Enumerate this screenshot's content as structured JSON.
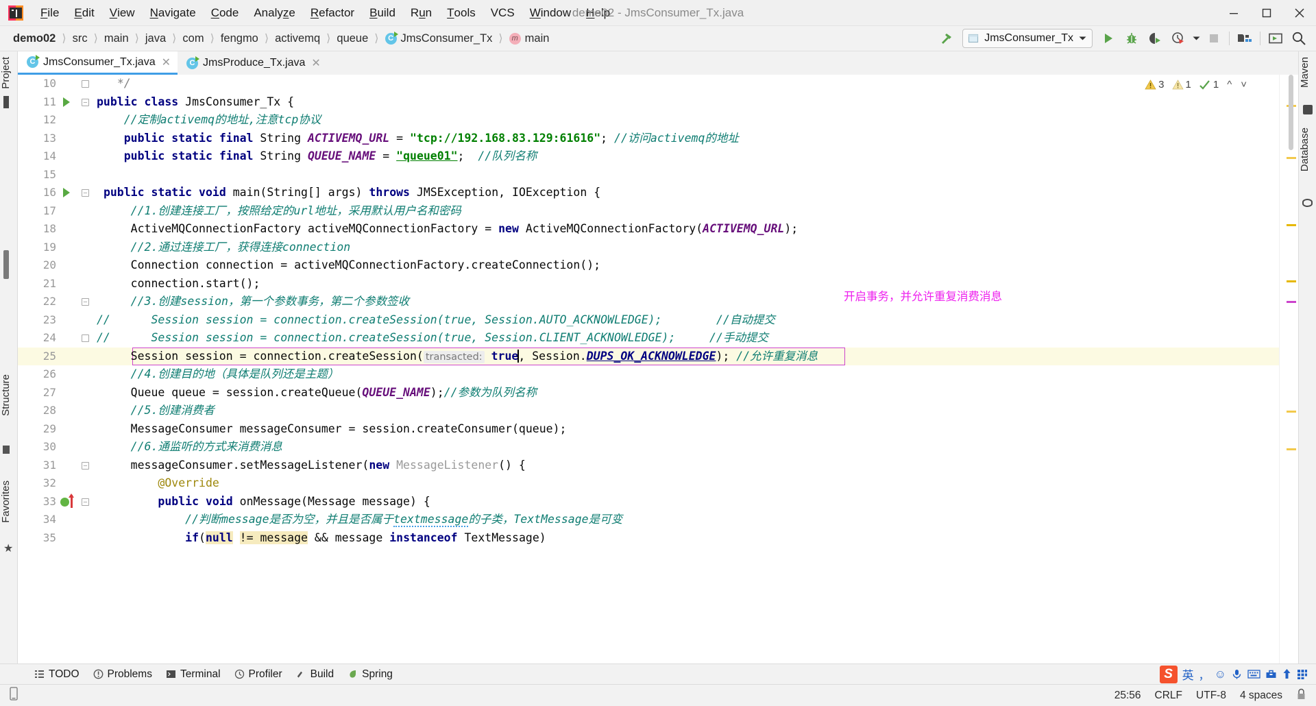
{
  "window": {
    "title": "demo02 - JmsConsumer_Tx.java",
    "minimize_icon": "minimize-icon",
    "maximize_icon": "maximize-icon",
    "close_icon": "close-icon"
  },
  "menubar": {
    "items": [
      {
        "label": "File",
        "mnemonic": "F"
      },
      {
        "label": "Edit",
        "mnemonic": "E"
      },
      {
        "label": "View",
        "mnemonic": "V"
      },
      {
        "label": "Navigate",
        "mnemonic": "N"
      },
      {
        "label": "Code",
        "mnemonic": "C"
      },
      {
        "label": "Analyze",
        "mnemonic": "z"
      },
      {
        "label": "Refactor",
        "mnemonic": "R"
      },
      {
        "label": "Build",
        "mnemonic": "B"
      },
      {
        "label": "Run",
        "mnemonic": "u"
      },
      {
        "label": "Tools",
        "mnemonic": "T"
      },
      {
        "label": "VCS",
        "mnemonic": ""
      },
      {
        "label": "Window",
        "mnemonic": "W"
      },
      {
        "label": "Help",
        "mnemonic": "H"
      }
    ]
  },
  "breadcrumbs": [
    {
      "label": "demo02",
      "icon": ""
    },
    {
      "label": "src",
      "icon": ""
    },
    {
      "label": "main",
      "icon": ""
    },
    {
      "label": "java",
      "icon": ""
    },
    {
      "label": "com",
      "icon": ""
    },
    {
      "label": "fengmo",
      "icon": ""
    },
    {
      "label": "activemq",
      "icon": ""
    },
    {
      "label": "queue",
      "icon": ""
    },
    {
      "label": "JmsConsumer_Tx",
      "icon": "class-icon"
    },
    {
      "label": "main",
      "icon": "method-icon"
    }
  ],
  "toolbar": {
    "build_icon": "hammer-icon",
    "run_config": "JmsConsumer_Tx",
    "run_config_icon": "application-icon",
    "dropdown_icon": "chevron-down-icon",
    "run_icon": "run-icon",
    "debug_icon": "debug-icon",
    "run_coverage_icon": "run-with-coverage-icon",
    "profile_icon": "profiler-icon",
    "profile_dropdown_icon": "chevron-down-icon",
    "stop_icon": "stop-icon",
    "project_structure_icon": "project-structure-icon",
    "terminal_icon": "open-terminal-icon",
    "search_icon": "search-everywhere-icon"
  },
  "left_strip": [
    {
      "label": "Project"
    },
    {
      "label": "Structure"
    },
    {
      "label": "Favorites"
    }
  ],
  "right_strip": [
    {
      "label": "Maven"
    },
    {
      "label": "Database"
    }
  ],
  "editor_tabs": [
    {
      "label": "JmsConsumer_Tx.java",
      "icon": "class-icon",
      "close_icon": "close-icon",
      "active": true
    },
    {
      "label": "JmsProduce_Tx.java",
      "icon": "class-icon",
      "close_icon": "close-icon",
      "active": false
    }
  ],
  "inspections": {
    "warnings_icon": "warning-triangle-icon",
    "warnings": "3",
    "weak_warnings_icon": "weak-warning-icon",
    "weak_warnings": "1",
    "typos_icon": "typo-check-icon",
    "typos": "1",
    "prev_icon": "chevron-up-icon",
    "next_icon": "chevron-down-icon"
  },
  "annotation": {
    "text": "开启事务，并允许重复消费消息",
    "color": "#ee22ee"
  },
  "code": {
    "first_line": 10,
    "lines": [
      {
        "n": 10,
        "fold": "end",
        "text": "*/",
        "indent": 1
      },
      {
        "n": 11,
        "run": true,
        "fold": "start",
        "text": "public class JmsConsumer_Tx {"
      },
      {
        "n": 12,
        "text": "//定制activemq的地址,注意tcp协议"
      },
      {
        "n": 13,
        "text": "public static final String ACTIVEMQ_URL = \"tcp://192.168.83.129:61616\"; //访问activemq的地址"
      },
      {
        "n": 14,
        "text": "public static final String QUEUE_NAME = \"queue01\";  //队列名称"
      },
      {
        "n": 15,
        "text": ""
      },
      {
        "n": 16,
        "run": true,
        "fold": "start",
        "text": "public static void main(String[] args) throws JMSException, IOException {"
      },
      {
        "n": 17,
        "text": "//1.创建连接工厂，按照给定的url地址，采用默认用户名和密码"
      },
      {
        "n": 18,
        "text": "ActiveMQConnectionFactory activeMQConnectionFactory = new ActiveMQConnectionFactory(ACTIVEMQ_URL);"
      },
      {
        "n": 19,
        "text": "//2.通过连接工厂，获得连接connection"
      },
      {
        "n": 20,
        "text": "Connection connection = activeMQConnectionFactory.createConnection();"
      },
      {
        "n": 21,
        "text": "connection.start();"
      },
      {
        "n": 22,
        "fold": "start",
        "text": "//3.创建session，第一个参数事务，第二个参数签收"
      },
      {
        "n": 23,
        "text": "//    Session session = connection.createSession(true, Session.AUTO_ACKNOWLEDGE);        //自动提交"
      },
      {
        "n": 24,
        "fold": "end",
        "text": "//    Session session = connection.createSession(true, Session.CLIENT_ACKNOWLEDGE);     //手动提交"
      },
      {
        "n": 25,
        "current": true,
        "text": "Session session = connection.createSession( transacted: true, Session.DUPS_OK_ACKNOWLEDGE); //允许重复消息"
      },
      {
        "n": 26,
        "text": "//4.创建目的地（具体是队列还是主题）"
      },
      {
        "n": 27,
        "text": "Queue queue = session.createQueue(QUEUE_NAME);//参数为队列名称"
      },
      {
        "n": 28,
        "text": "//5.创建消费者"
      },
      {
        "n": 29,
        "text": "MessageConsumer messageConsumer = session.createConsumer(queue);"
      },
      {
        "n": 30,
        "text": "//6.通监听的方式来消费消息"
      },
      {
        "n": 31,
        "fold": "start",
        "text": "messageConsumer.setMessageListener(new MessageListener() {"
      },
      {
        "n": 32,
        "text": "@Override"
      },
      {
        "n": 33,
        "breakpoint": true,
        "fold": "start",
        "text": "public void onMessage(Message message) {"
      },
      {
        "n": 34,
        "text": "//判断message是否为空，并且是否属于textmessage的子类，TextMessage是可变"
      },
      {
        "n": 35,
        "text": "if(null != message && message instanceof TextMessage)"
      }
    ]
  },
  "bottom_tools": [
    {
      "label": "TODO",
      "icon": "todo-icon"
    },
    {
      "label": "Problems",
      "icon": "problems-icon"
    },
    {
      "label": "Terminal",
      "icon": "terminal-icon"
    },
    {
      "label": "Profiler",
      "icon": "profiler-icon"
    },
    {
      "label": "Build",
      "icon": "build-icon"
    },
    {
      "label": "Spring",
      "icon": "spring-icon"
    }
  ],
  "ime_tray": [
    {
      "icon": "sogou-logo-icon",
      "label": "S"
    },
    {
      "icon": "chinese-mode-icon",
      "label": "英"
    },
    {
      "icon": "punctuation-icon",
      "label": "，"
    },
    {
      "icon": "emoji-icon",
      "label": "☺"
    },
    {
      "icon": "voice-input-icon",
      "label": "🎤"
    },
    {
      "icon": "keyboard-icon",
      "label": "⌨"
    },
    {
      "icon": "toolbox-icon",
      "label": "🧰"
    },
    {
      "icon": "upload-icon",
      "label": "⬆"
    },
    {
      "icon": "apps-icon",
      "label": "⠿"
    }
  ],
  "statusbar": {
    "memory_icon": "memory-indicator-icon",
    "caret_position": "25:56",
    "line_separator": "CRLF",
    "encoding": "UTF-8",
    "indent": "4 spaces",
    "lock_icon": "read-only-toggle-icon"
  }
}
